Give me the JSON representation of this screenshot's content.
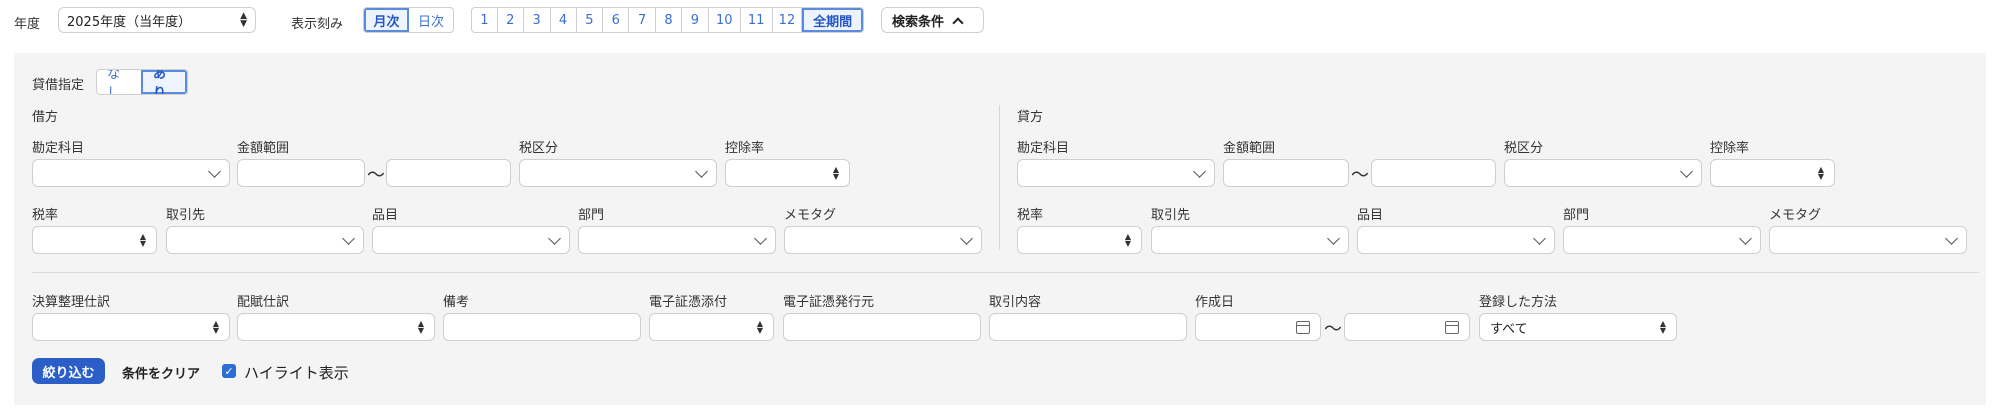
{
  "toolbar": {
    "year_label": "年度",
    "year_value": "2025年度（当年度）",
    "interval_label": "表示刻み",
    "interval_options": [
      "月次",
      "日次"
    ],
    "interval_selected": "月次",
    "months": [
      "1",
      "2",
      "3",
      "4",
      "5",
      "6",
      "7",
      "8",
      "9",
      "10",
      "11",
      "12",
      "全期間"
    ],
    "month_selected": "全期間",
    "search_conditions_label": "検索条件"
  },
  "filters": {
    "debit_credit_label": "貸借指定",
    "debit_credit_options": [
      "なし",
      "あり"
    ],
    "debit_credit_selected": "あり",
    "debit": {
      "heading": "借方",
      "account_label": "勘定科目",
      "amount_range_label": "金額範囲",
      "tax_category_label": "税区分",
      "deduction_rate_label": "控除率",
      "tax_rate_label": "税率",
      "partner_label": "取引先",
      "item_label": "品目",
      "department_label": "部門",
      "memo_tag_label": "メモタグ"
    },
    "credit": {
      "heading": "貸方",
      "account_label": "勘定科目",
      "amount_range_label": "金額範囲",
      "tax_category_label": "税区分",
      "deduction_rate_label": "控除率",
      "tax_rate_label": "税率",
      "partner_label": "取引先",
      "item_label": "品目",
      "department_label": "部門",
      "memo_tag_label": "メモタグ"
    },
    "tilde": "〜",
    "closing_entry_label": "決算整理仕訳",
    "allocation_entry_label": "配賦仕訳",
    "remarks_label": "備考",
    "e_doc_attached_label": "電子証憑添付",
    "e_doc_issuer_label": "電子証憑発行元",
    "transaction_content_label": "取引内容",
    "created_date_label": "作成日",
    "registration_method_label": "登録した方法",
    "registration_method_value": "すべて"
  },
  "actions": {
    "filter_button": "絞り込む",
    "clear_button": "条件をクリア",
    "highlight_label": "ハイライト表示",
    "highlight_checked": true
  },
  "colors": {
    "primary": "#2b5fc7",
    "active_border": "#5a8be0",
    "panel_bg": "#f5f4f4"
  }
}
